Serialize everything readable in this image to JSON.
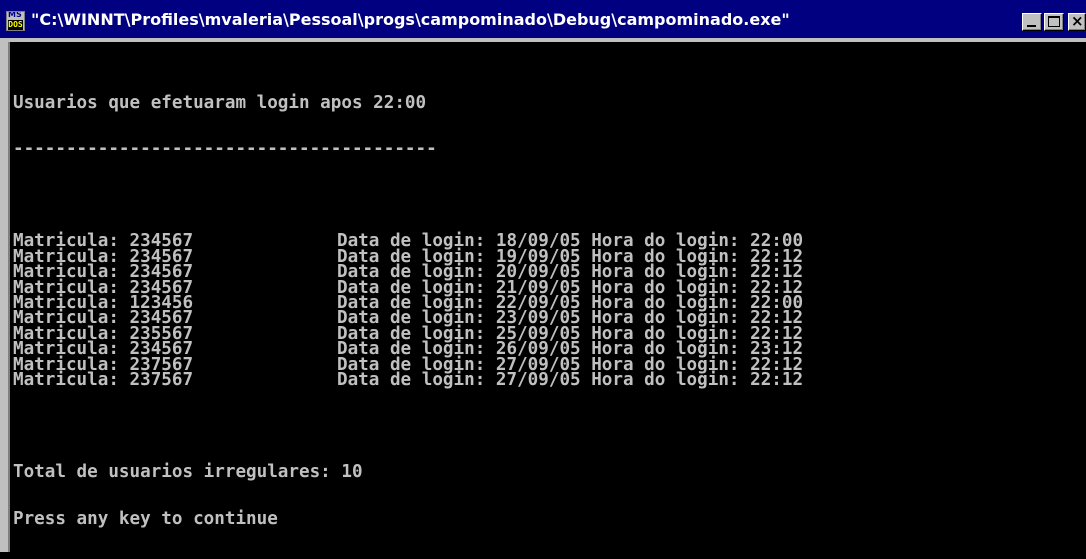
{
  "window": {
    "icon_top": "MS",
    "icon_bottom": "DOS",
    "title": "\"C:\\WINNT\\Profiles\\mvaleria\\Pessoal\\progs\\campominado\\Debug\\campominado.exe\""
  },
  "console": {
    "heading": "Usuarios que efetuaram login apos 22:00",
    "separator": "----------------------------------------",
    "rows": [
      {
        "matricula": "Matricula: 234567",
        "detail": "Data de login: 18/09/05 Hora do login: 22:00"
      },
      {
        "matricula": "Matricula: 234567",
        "detail": "Data de login: 19/09/05 Hora do login: 22:12"
      },
      {
        "matricula": "Matricula: 234567",
        "detail": "Data de login: 20/09/05 Hora do login: 22:12"
      },
      {
        "matricula": "Matricula: 234567",
        "detail": "Data de login: 21/09/05 Hora do login: 22:12"
      },
      {
        "matricula": "Matricula: 123456",
        "detail": "Data de login: 22/09/05 Hora do login: 22:00"
      },
      {
        "matricula": "Matricula: 234567",
        "detail": "Data de login: 23/09/05 Hora do login: 22:12"
      },
      {
        "matricula": "Matricula: 235567",
        "detail": "Data de login: 25/09/05 Hora do login: 22:12"
      },
      {
        "matricula": "Matricula: 234567",
        "detail": "Data de login: 26/09/05 Hora do login: 23:12"
      },
      {
        "matricula": "Matricula: 237567",
        "detail": "Data de login: 27/09/05 Hora do login: 22:12"
      },
      {
        "matricula": "Matricula: 237567",
        "detail": "Data de login: 27/09/05 Hora do login: 22:12"
      }
    ],
    "total": "Total de usuarios irregulares: 10",
    "prompt": "Press any key to continue"
  },
  "colors": {
    "titlebar": "#000080",
    "console_bg": "#000000",
    "console_text": "#c0c0c0"
  }
}
